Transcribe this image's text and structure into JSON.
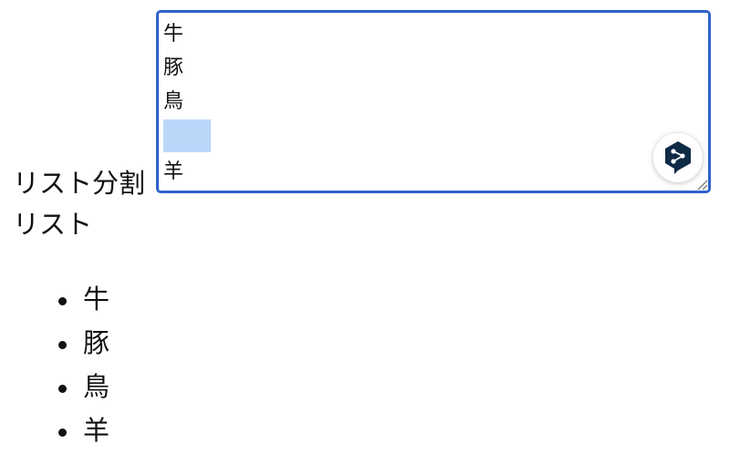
{
  "split_label": "リスト分割",
  "textarea": {
    "lines": [
      "牛",
      "豚",
      "鳥",
      "",
      "羊"
    ],
    "selected_line": 3,
    "border_color": "#2f63c9",
    "selection_color": "#bcd6fa"
  },
  "deepl_icon": "deepl-translate-icon",
  "list": {
    "title": "リスト",
    "items": [
      "牛",
      "豚",
      "鳥",
      "羊"
    ]
  }
}
